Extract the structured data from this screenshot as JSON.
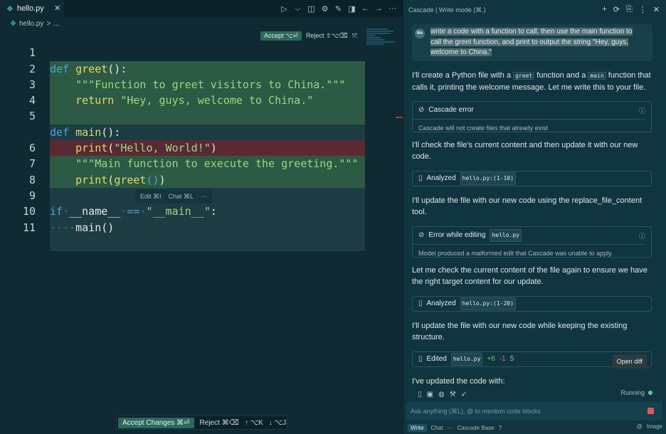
{
  "editor": {
    "tab": {
      "label": "hello.py",
      "close": "✕"
    },
    "toolbar": {
      "icons": [
        "play",
        "chevron",
        "split-layout",
        "settings",
        "pencil",
        "panel",
        "arrow-left",
        "arrow-right",
        "more"
      ],
      "glyphs": [
        "▷",
        "⌵",
        "◫",
        "⚙",
        "✎",
        "◨",
        "←",
        "→",
        "···"
      ]
    },
    "breadcrumb": {
      "file": "hello.py",
      "sep": ">",
      "rest": "..."
    },
    "accept_bar": {
      "accept": "Accept ⌥⏎",
      "reject": "Reject ⇧⌥⌫",
      "collapse": "⤧"
    },
    "lines": [
      {
        "n": "1",
        "bg": "add"
      },
      {
        "n": "2",
        "bg": "add"
      },
      {
        "n": "3",
        "bg": "add"
      },
      {
        "n": "4",
        "bg": "add"
      },
      {
        "n": "5",
        "bg": "edit"
      },
      {
        "n": "",
        "bg": "del"
      },
      {
        "n": "6",
        "bg": "add"
      },
      {
        "n": "7",
        "bg": "add"
      },
      {
        "n": "8",
        "bg": "edit"
      },
      {
        "n": "9",
        "bg": "edit"
      },
      {
        "n": "10",
        "bg": "edit"
      },
      {
        "n": "11",
        "bg": "edit"
      }
    ],
    "code": {
      "l1_kw": "def",
      "l1_fn": "greet",
      "l1_rest": "():",
      "l2": "\"\"\"Function to greet visitors to China.\"\"\"",
      "l3_kw": "return",
      "l3_str": "\"Hey, guys, welcome to China.\"",
      "l5_kw": "def",
      "l5_fn": "main",
      "l5_rest": "():",
      "l5b_fn": "print",
      "l5b_str": "\"Hello, World!\"",
      "l5b_rest": ")",
      "l6": "\"\"\"Main function to execute the greeting.\"\"\"",
      "l7_fn": "print",
      "l7_a": "(",
      "l7_g": "greet",
      "l7_b": "()",
      "l7_c": ")",
      "l9_kw": "if",
      "l9_name": "__name__",
      "l9_eq": "==",
      "l9_str": "\"__main__\"",
      "l9_colon": ":",
      "l10_fn": "main",
      "l10_rest": "()"
    },
    "inline_menu": {
      "edit": "Edit ⌘I",
      "chat": "Chat ⌘L",
      "more": "···"
    },
    "bottom_bar": {
      "accept": "Accept Changes ⌘⏎",
      "reject": "Reject ⌘⌫",
      "prev": "↑ ⌥K",
      "next": "↓ ⌥J"
    }
  },
  "cascade": {
    "title": "Cascade | Write mode (⌘.)",
    "header_icons": [
      "+",
      "⟳",
      "⎘",
      "⋮",
      "✕"
    ],
    "user_avatar": "Me",
    "user_message": "write a code with a function to call, then use the main function to call the greet function, and print to output the string \"Hey, guys, welcome to China.\"",
    "p1_a": "I'll create a Python file with a ",
    "p1_code1": "greet",
    "p1_b": " function and a ",
    "p1_code2": "main",
    "p1_c": " function that calls it, printing the welcome message. Let me write this to your file.",
    "card_error_title": "Cascade error",
    "card_error_sub": "Cascade will not create files that already exist",
    "p2": "I'll check the file's current content and then update it with our new code.",
    "card_analyzed1_label": "Analyzed",
    "card_analyzed1_code": "hello.py:(1-10)",
    "p3": "I'll update the file with our new code using the replace_file_content tool.",
    "card_err2_title": "Error while editing",
    "card_err2_code": "hello.py",
    "card_err2_sub": "Model produced a malformed edit that Cascade was unable to apply.",
    "p4": "Let me check the current content of the file again to ensure we have the right target content for our update.",
    "card_analyzed2_label": "Analyzed",
    "card_analyzed2_code": "hello.py:(1-20)",
    "p5": "I'll update the file with our new code while keeping the existing structure.",
    "card_edited_label": "Edited",
    "card_edited_code": "hello.py",
    "card_edited_plus": "+6",
    "card_edited_minus": "-1",
    "card_edited_num": "5",
    "card_edited_btn": "Open diff",
    "p6": "I've updated the code with:",
    "running": "Running",
    "input_placeholder": "Ask anything (⌘L), @ to mention code blocks",
    "footer": {
      "write": "Write",
      "chat": "Chat",
      "more": "···",
      "model": "Cascade Base",
      "help": "?",
      "image": "Image",
      "at": "@"
    }
  }
}
